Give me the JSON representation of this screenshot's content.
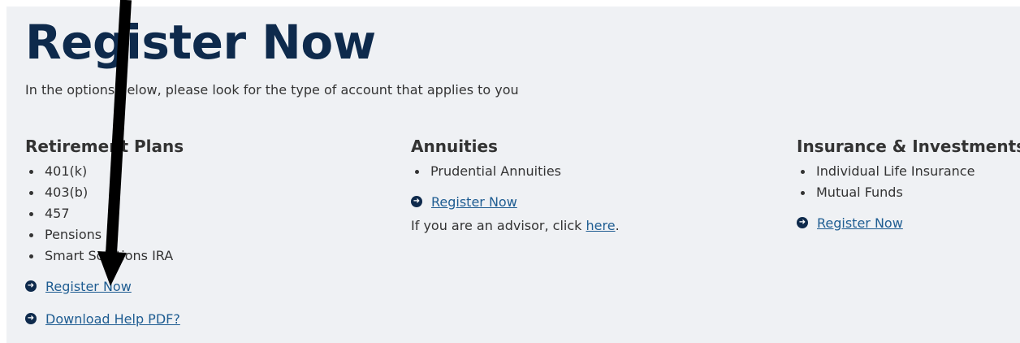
{
  "title": "Register Now",
  "intro": "In the options below, please look for the type of account that applies to you",
  "columns": [
    {
      "heading": "Retirement Plans",
      "items": [
        "401(k)",
        "403(b)",
        "457",
        "Pensions",
        "Smart Solutions IRA"
      ],
      "links": [
        "Register Now",
        "Download Help PDF?"
      ]
    },
    {
      "heading": "Annuities",
      "items": [
        "Prudential Annuities"
      ],
      "links": [
        "Register Now"
      ],
      "advisor_prefix": "If you are an advisor, click ",
      "advisor_link": "here",
      "advisor_suffix": "."
    },
    {
      "heading": "Insurance & Investments",
      "items": [
        "Individual Life Insurance",
        "Mutual Funds"
      ],
      "links": [
        "Register Now"
      ]
    }
  ],
  "link_icon": "circle-arrow-right-icon",
  "colors": {
    "title": "#0e2a4c",
    "link": "#1f5d92",
    "panel": "#eff1f4",
    "text": "#333333",
    "annotation": "#000000"
  }
}
